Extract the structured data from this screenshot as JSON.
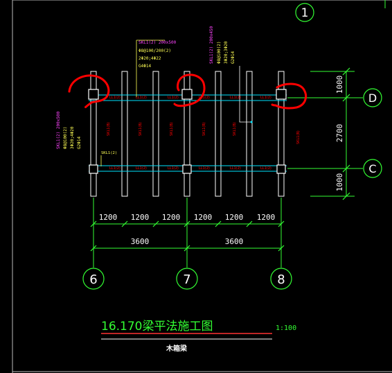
{
  "title": "16.170梁平法施工图",
  "scale": "1:100",
  "subtitle": "木箱梁",
  "axes": {
    "top_circle": "1",
    "row_d": "D",
    "row_c": "C",
    "col_6": "6",
    "col_7": "7",
    "col_8": "8"
  },
  "dimensions": {
    "bays": [
      "1200",
      "1200",
      "1200",
      "1200",
      "1200",
      "1200"
    ],
    "spans": [
      "3600",
      "3600"
    ],
    "right": [
      "1000",
      "2700",
      "1000"
    ]
  },
  "annotations": {
    "top_left_mag": "SKL1(2) 200x500",
    "top_left_yel": [
      "Φ8@100/200(2)",
      "2Φ20;4Φ22",
      "G4Φ14"
    ],
    "top_mid_mag": "SKL1(2) 200x450",
    "top_mid_yel": [
      "Φ8@100(2)",
      "3Φ20;3Φ20",
      "G2Φ14"
    ],
    "left_mag": "SKL1(2) 200x500",
    "left_yel": [
      "Φ8@100(2)",
      "3Φ20;4Φ20",
      "G2Φ14"
    ],
    "skl1_a": "SKL1(2)"
  },
  "beam_labels": {
    "top": [
      "LL1(2)",
      "LL1(2)",
      "LL1(2)",
      "LL1(2)",
      "LL1(2)",
      "LL1(2)"
    ],
    "bottom": [
      "LL1(2)",
      "LL1(2)",
      "LL1(2)",
      "LL1(2)",
      "LL1(2)",
      "LL1(2)"
    ],
    "vertical": [
      "SKL1(B)",
      "SKL1(B)",
      "SKL1(B)",
      "SKL1(B)",
      "SKL1(B)",
      "SKL1(B)"
    ]
  },
  "colors": {
    "background": "#000000",
    "grid": "#33ff33",
    "structure": "#ffffff",
    "beam": "#00e5ff",
    "highlight": "#ff0000",
    "magenta": "#ff44ff",
    "yellow": "#ffff55"
  }
}
